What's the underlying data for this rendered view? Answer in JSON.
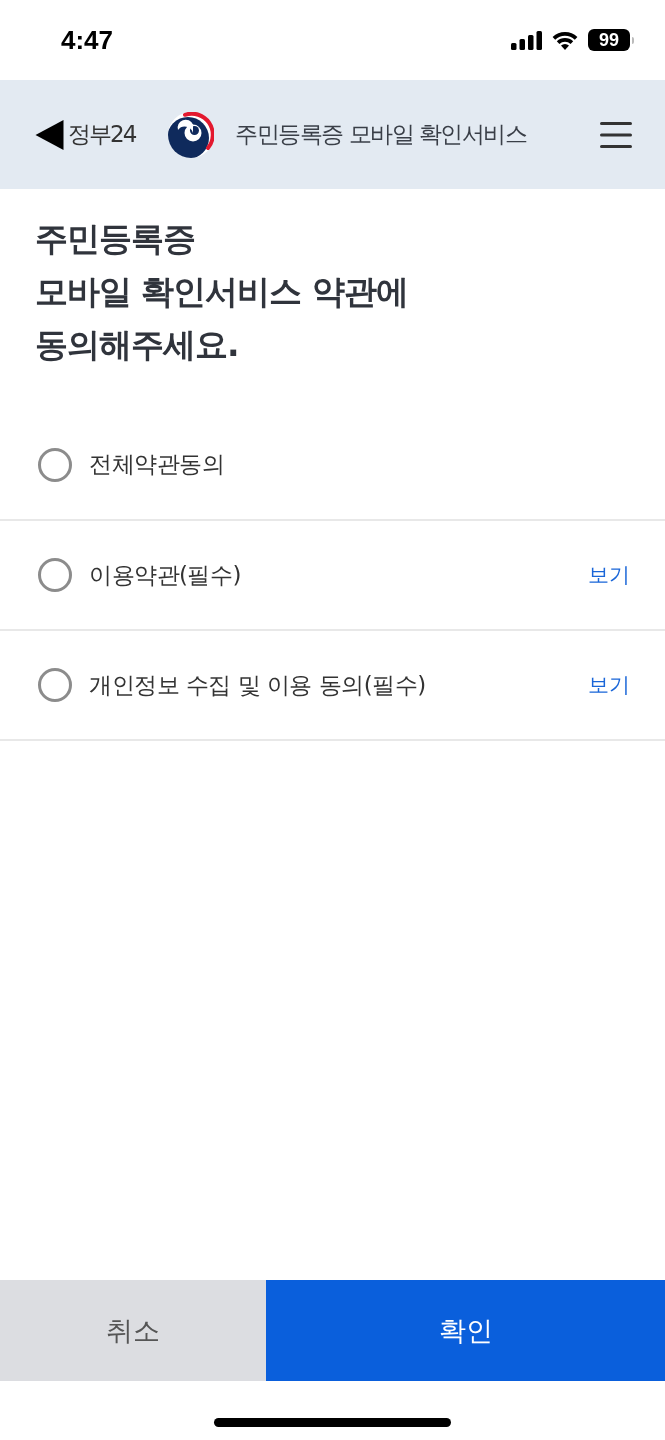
{
  "status_bar": {
    "time": "4:47",
    "battery": "99"
  },
  "header": {
    "back_label": "정부24",
    "title": "주민등록증 모바일 확인서비스"
  },
  "heading": "주민등록증\n모바일 확인서비스 약관에\n동의해주세요.",
  "agreements": [
    {
      "label": "전체약관동의",
      "checked": false
    },
    {
      "label": "이용약관(필수)",
      "checked": false,
      "link": "보기"
    },
    {
      "label": "개인정보 수집 및 이용 동의(필수)",
      "checked": false,
      "link": "보기"
    }
  ],
  "buttons": [
    {
      "label": "취소",
      "kind": "secondary"
    },
    {
      "label": "확인",
      "kind": "primary"
    }
  ]
}
